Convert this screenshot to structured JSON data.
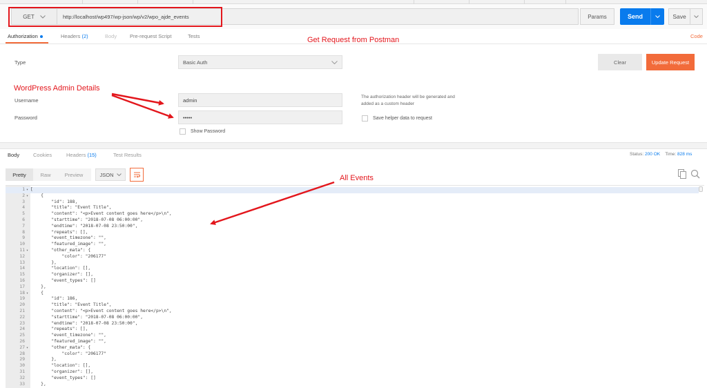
{
  "request": {
    "method": "GET",
    "url": "http://localhost/wp497/wp-json/wp/v2/wpo_ajde_events",
    "params_label": "Params",
    "send_label": "Send",
    "save_label": "Save"
  },
  "request_tabs": {
    "authorization": "Authorization",
    "headers": "Headers",
    "headers_count": "(2)",
    "body": "Body",
    "prerequest": "Pre-request Script",
    "tests": "Tests",
    "code": "Code"
  },
  "annotations": {
    "get_request": "Get Request from Postman",
    "admin_details": "WordPress Admin Details",
    "all_events": "All Events"
  },
  "auth": {
    "type_label": "Type",
    "type_value": "Basic Auth",
    "clear_label": "Clear",
    "update_label": "Update Request",
    "username_label": "Username",
    "username_value": "admin",
    "password_label": "Password",
    "password_value": "•••••",
    "show_password": "Show Password",
    "info_line1": "The authorization header will be generated and",
    "info_line2": "added as a custom header",
    "save_helper": "Save helper data to request"
  },
  "response_tabs": {
    "body": "Body",
    "cookies": "Cookies",
    "headers": "Headers",
    "headers_count": "(15)",
    "test_results": "Test Results"
  },
  "status": {
    "status_label": "Status:",
    "status_value": "200 OK",
    "time_label": "Time:",
    "time_value": "828 ms"
  },
  "view": {
    "pretty": "Pretty",
    "raw": "Raw",
    "preview": "Preview",
    "format": "JSON"
  },
  "icons": {
    "method_chevron": "chevron-down-icon",
    "send_chevron": "chevron-down-icon",
    "save_chevron": "chevron-down-icon",
    "wrap": "wrap-lines-icon",
    "copy": "copy-icon",
    "search": "search-icon"
  },
  "colors": {
    "send_blue": "#097bed",
    "accent_orange": "#f26b3a",
    "annotation_red": "#e3161c"
  },
  "code_lines": [
    {
      "n": "1",
      "fold": true,
      "text": "["
    },
    {
      "n": "2",
      "fold": true,
      "text": "    {"
    },
    {
      "n": "3",
      "fold": false,
      "text": "        \"id\": 188,"
    },
    {
      "n": "4",
      "fold": false,
      "text": "        \"title\": \"Event Title\","
    },
    {
      "n": "5",
      "fold": false,
      "text": "        \"content\": \"<p>Event content goes here</p>\\n\","
    },
    {
      "n": "6",
      "fold": false,
      "text": "        \"starttime\": \"2018-07-08 06:00:00\","
    },
    {
      "n": "7",
      "fold": false,
      "text": "        \"endtime\": \"2018-07-08 23:50:00\","
    },
    {
      "n": "8",
      "fold": false,
      "text": "        \"repeats\": [],"
    },
    {
      "n": "9",
      "fold": false,
      "text": "        \"event_timezone\": \"\","
    },
    {
      "n": "10",
      "fold": false,
      "text": "        \"featured_image\": \"\","
    },
    {
      "n": "11",
      "fold": true,
      "text": "        \"other_mata\": {"
    },
    {
      "n": "12",
      "fold": false,
      "text": "            \"color\": \"206177\""
    },
    {
      "n": "13",
      "fold": false,
      "text": "        },"
    },
    {
      "n": "14",
      "fold": false,
      "text": "        \"location\": [],"
    },
    {
      "n": "15",
      "fold": false,
      "text": "        \"organizer\": [],"
    },
    {
      "n": "16",
      "fold": false,
      "text": "        \"event_types\": []"
    },
    {
      "n": "17",
      "fold": false,
      "text": "    },"
    },
    {
      "n": "18",
      "fold": true,
      "text": "    {"
    },
    {
      "n": "19",
      "fold": false,
      "text": "        \"id\": 186,"
    },
    {
      "n": "20",
      "fold": false,
      "text": "        \"title\": \"Event Title\","
    },
    {
      "n": "21",
      "fold": false,
      "text": "        \"content\": \"<p>Event content goes here</p>\\n\","
    },
    {
      "n": "22",
      "fold": false,
      "text": "        \"starttime\": \"2018-07-08 06:00:00\","
    },
    {
      "n": "23",
      "fold": false,
      "text": "        \"endtime\": \"2018-07-08 23:50:00\","
    },
    {
      "n": "24",
      "fold": false,
      "text": "        \"repeats\": [],"
    },
    {
      "n": "25",
      "fold": false,
      "text": "        \"event_timezone\": \"\","
    },
    {
      "n": "26",
      "fold": false,
      "text": "        \"featured_image\": \"\","
    },
    {
      "n": "27",
      "fold": true,
      "text": "        \"other_mata\": {"
    },
    {
      "n": "28",
      "fold": false,
      "text": "            \"color\": \"206177\""
    },
    {
      "n": "29",
      "fold": false,
      "text": "        },"
    },
    {
      "n": "30",
      "fold": false,
      "text": "        \"location\": [],"
    },
    {
      "n": "31",
      "fold": false,
      "text": "        \"organizer\": [],"
    },
    {
      "n": "32",
      "fold": false,
      "text": "        \"event_types\": []"
    },
    {
      "n": "33",
      "fold": false,
      "text": "    },"
    }
  ]
}
